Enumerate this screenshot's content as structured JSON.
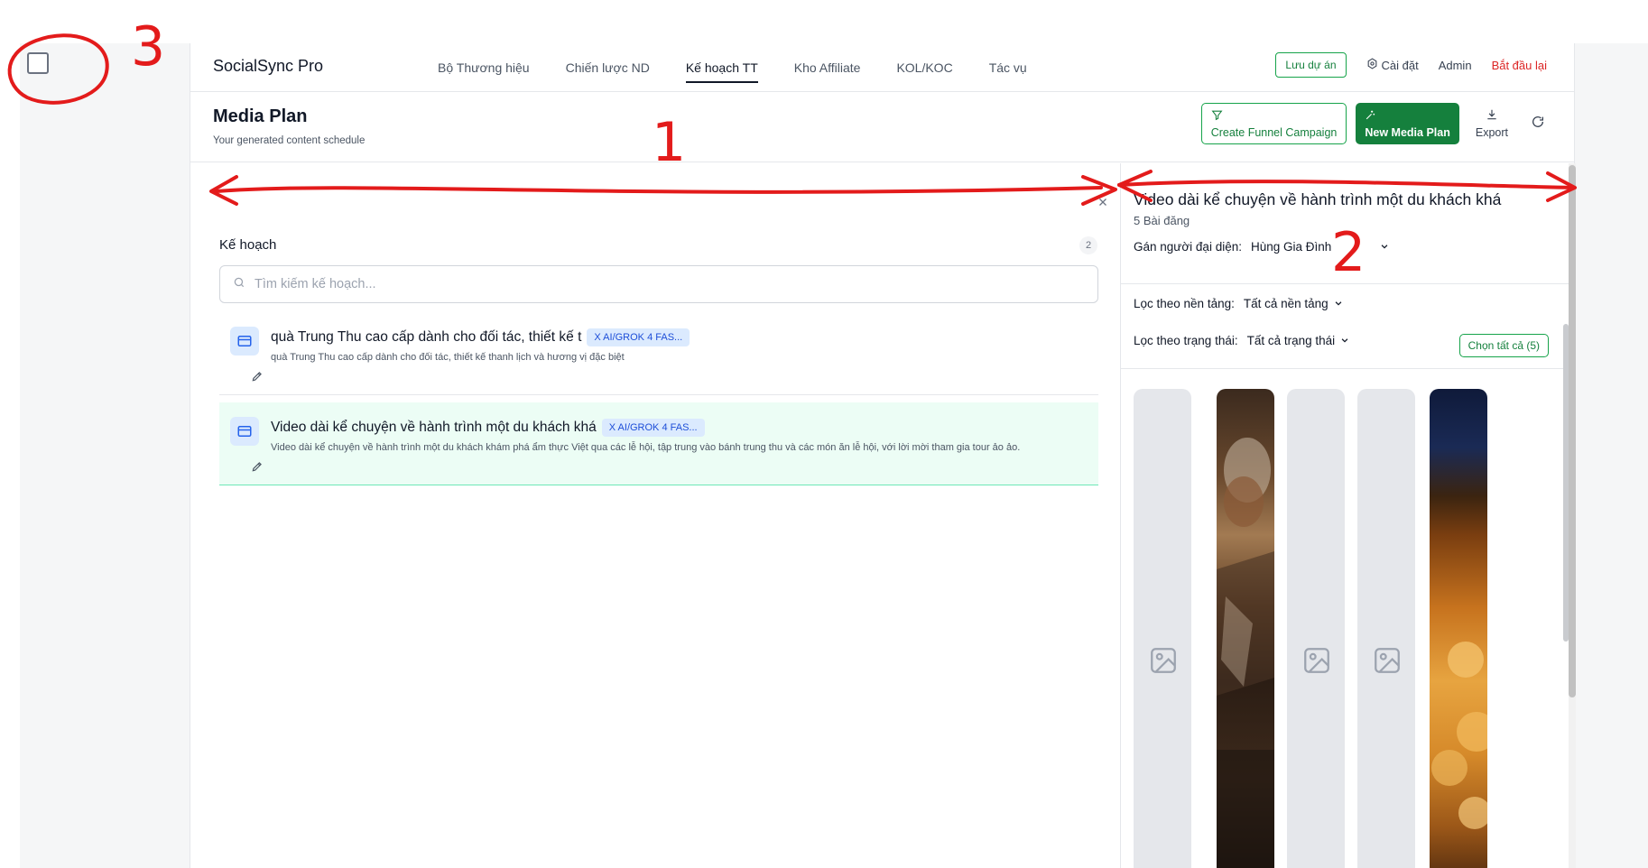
{
  "app": {
    "brand": "SocialSync Pro"
  },
  "nav": {
    "tabs": [
      "Bộ Thương hiệu",
      "Chiến lược ND",
      "Kế hoạch TT",
      "Kho Affiliate",
      "KOL/KOC",
      "Tác vụ"
    ],
    "active_tab": "Kế hoạch TT",
    "save_label": "Lưu dự án",
    "settings_label": "Cài đặt",
    "admin_label": "Admin",
    "restart_label": "Bắt đầu lại"
  },
  "header": {
    "title": "Media Plan",
    "subtitle": "Your generated content schedule",
    "funnel_label": "Create Funnel Campaign",
    "new_plan_label": "New Media Plan",
    "export_label": "Export"
  },
  "plans": {
    "heading": "Kế hoạch",
    "count": "2",
    "search_placeholder": "Tìm kiếm kế hoạch...",
    "items": [
      {
        "title": "quà Trung Thu cao cấp dành cho đối tác, thiết kế t",
        "badge": "X AI/GROK 4 FAS...",
        "desc": "quà Trung Thu cao cấp dành cho đối tác, thiết kế thanh lịch và hương vị đặc biệt"
      },
      {
        "title": "Video dài kể chuyện về hành trình một du khách khá",
        "badge": "X AI/GROK 4 FAS...",
        "desc": "Video dài kể chuyện về hành trình một du khách khám phá ẩm thực Việt qua các lễ hội, tập trung vào bánh trung thu và các món ăn lễ hội, với lời mời tham gia tour ảo ảo."
      }
    ]
  },
  "detail": {
    "title": "Video dài kể chuyện về hành trình một du khách khá",
    "post_count": "5 Bài đăng",
    "assign_label": "Gán người đại diện:",
    "assign_value": "Hùng Gia Đình",
    "platform_filter_label": "Lọc theo nền tảng:",
    "platform_filter_value": "Tất cả nền tảng",
    "status_filter_label": "Lọc theo trạng thái:",
    "status_filter_value": "Tất cả trạng thái",
    "select_all_label": "Chọn tất cả (5)"
  },
  "annotations": [
    "1",
    "2",
    "3"
  ],
  "colors": {
    "accent": "#15803d",
    "danger": "#dc2626",
    "badge_bg": "#dbeafe",
    "selected_bg": "#ecfdf5",
    "annotation": "#e31b1b"
  }
}
